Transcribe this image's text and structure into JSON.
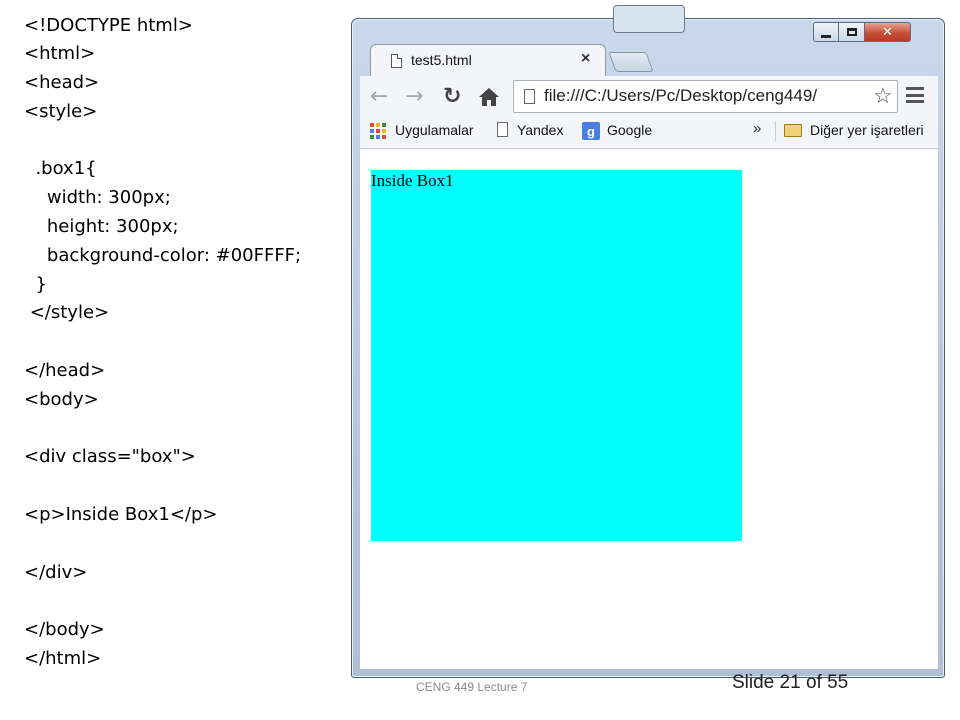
{
  "code_lines": [
    "<!DOCTYPE html>",
    "<html>",
    "<head>",
    "<style>",
    "  .box1{",
    "    width: 300px;",
    "    height: 300px;",
    "    background-color: #00FFFF;",
    "  }",
    " </style>",
    "</head>",
    "<body>",
    "<div class=\"box\">",
    "<p>Inside Box1</p>",
    "</div>",
    "</body>",
    "</html>"
  ],
  "browser": {
    "tab_title": "test5.html",
    "tab_close": "×",
    "url": "file:///C:/Users/Pc/Desktop/ceng449/",
    "back_icon": "←",
    "forward_icon": "→",
    "reload_icon": "↻",
    "star_icon": "☆",
    "window_close": "✕",
    "bookmarks": {
      "apps": "Uygulamalar",
      "yandex": "Yandex",
      "google": "Google",
      "google_glyph": "g",
      "more": "»",
      "other": "Diğer yer işaretleri"
    },
    "colors": {
      "box_bg": "#00FFFF"
    }
  },
  "page": {
    "box_text": "Inside Box1"
  },
  "footer": {
    "course": "CENG 449 Lecture 7",
    "slide": "Slide 21 of 55"
  }
}
